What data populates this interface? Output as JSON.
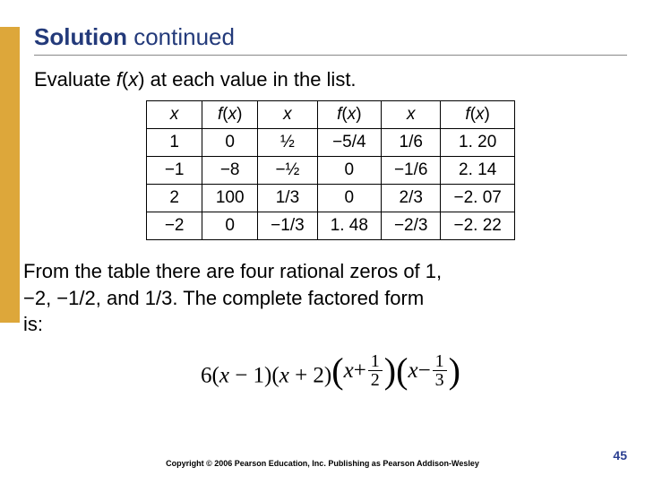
{
  "title_strong": "Solution",
  "title_rest": " continued",
  "instruction_pre": "Evaluate ",
  "instruction_func": "f",
  "instruction_paren_open": "(",
  "instruction_var": "x",
  "instruction_paren_close": ")",
  "instruction_post": " at each value in the list.",
  "table_headers": [
    "x",
    "f(x)",
    "x",
    "f(x)",
    "x",
    "f(x)"
  ],
  "rows": [
    [
      "1",
      "0",
      "½",
      "−5/4",
      "1/6",
      "1. 20"
    ],
    [
      "−1",
      "−8",
      "−½",
      "0",
      "−1/6",
      "2. 14"
    ],
    [
      "2",
      "100",
      "1/3",
      "0",
      "2/3",
      "−2. 07"
    ],
    [
      "−2",
      "0",
      "−1/3",
      "1. 48",
      "−2/3",
      "−2. 22"
    ]
  ],
  "conclusion_line1": "From the table there are four rational zeros of 1,",
  "conclusion_line2": "−2, −1/2, and 1/3. The complete factored form",
  "conclusion_line3": "is:",
  "formula": {
    "lead": "6",
    "group1": "(x − 1)",
    "group2": "(x + 2)",
    "group3_frac_num": "1",
    "group3_frac_den": "2",
    "group4_frac_num": "1",
    "group4_frac_den": "3",
    "x_plus": "x +",
    "x_minus": "x −"
  },
  "copyright": "Copyright © 2006 Pearson Education, Inc.  Publishing as Pearson Addison-Wesley",
  "slide_number": "45",
  "chart_data": {
    "type": "table",
    "title": "Evaluate f(x) at each value in the list",
    "columns": [
      "x",
      "f(x)",
      "x",
      "f(x)",
      "x",
      "f(x)"
    ],
    "rows": [
      [
        "1",
        "0",
        "1/2",
        "-5/4",
        "1/6",
        "1.20"
      ],
      [
        "-1",
        "-8",
        "-1/2",
        "0",
        "-1/6",
        "2.14"
      ],
      [
        "2",
        "100",
        "1/3",
        "0",
        "2/3",
        "-2.07"
      ],
      [
        "-2",
        "0",
        "-1/3",
        "1.48",
        "-2/3",
        "-2.22"
      ]
    ],
    "rational_zeros": [
      "1",
      "-2",
      "-1/2",
      "1/3"
    ],
    "factored_form": "6(x-1)(x+2)(x+1/2)(x-1/3)"
  }
}
